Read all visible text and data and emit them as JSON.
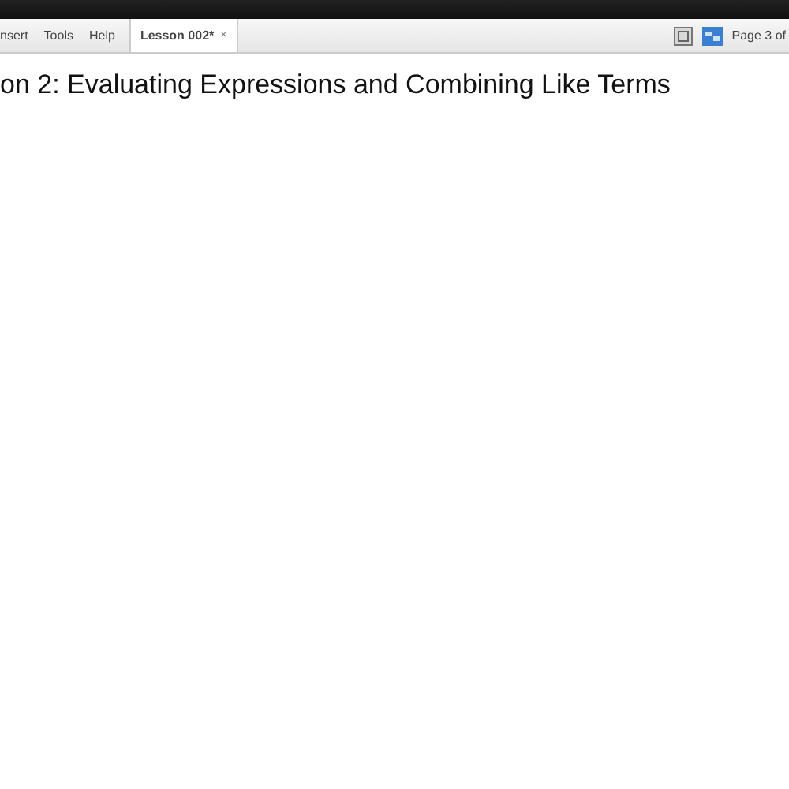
{
  "menu": [
    "nsert",
    "Tools",
    "Help"
  ],
  "tabs": [
    {
      "label": "Lesson 002*",
      "selected": true,
      "close": "×"
    }
  ],
  "page_indicator": "Page 3 of",
  "page_title": "on 2: Evaluating Expressions and Combining Like Terms"
}
